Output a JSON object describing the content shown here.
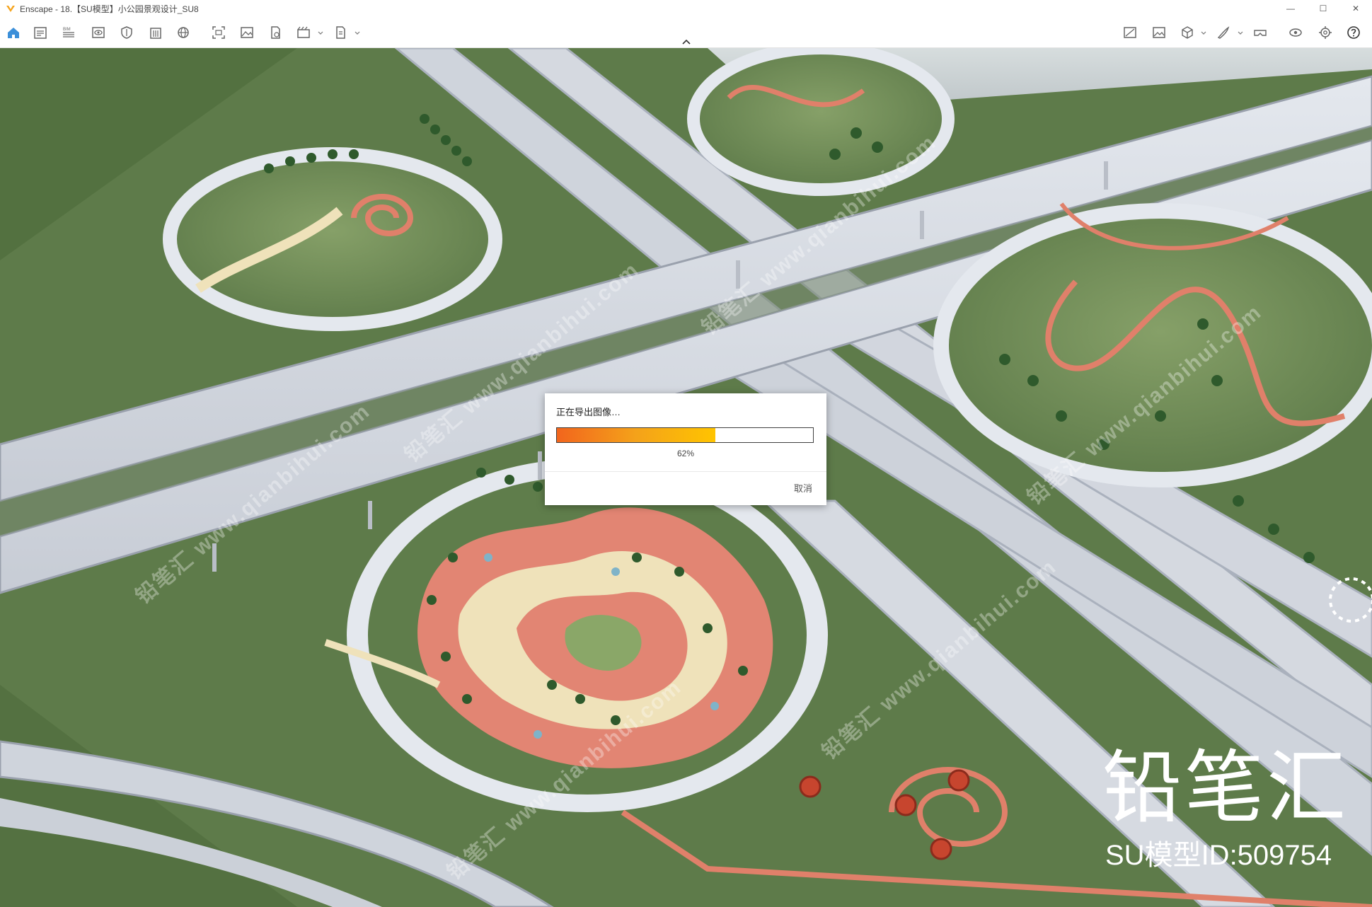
{
  "window": {
    "title": "Enscape - 18.【SU模型】小公园景观设计_SU8",
    "minimize": "—",
    "maximize": "☐",
    "close": "✕"
  },
  "toolbar": {
    "left_icons": [
      "home-icon",
      "document-icon",
      "bim-icon",
      "eye-icon",
      "shield-icon",
      "building-icon",
      "globe-icon",
      "screenshot-icon",
      "image-icon",
      "export-icon",
      "video-icon",
      "file-export-icon"
    ],
    "right_icons": [
      "asset-library-icon",
      "gallery-icon",
      "cube-icon",
      "brush-icon",
      "vr-headset-icon",
      "visibility-icon",
      "settings-icon",
      "help-icon"
    ]
  },
  "dialog": {
    "title": "正在导出图像…",
    "progress_value": 0.62,
    "progress_text": "62%",
    "cancel": "取消"
  },
  "watermark": {
    "brand": "铅笔汇",
    "model_id": "SU模型ID:509754",
    "diagonal_text": "铅笔汇 www.qianbihui.com"
  },
  "colors": {
    "grass": "#5d7a49",
    "road": "#d3d8df",
    "path_red": "#e0806a",
    "path_cream": "#efe2ba",
    "progress_start": "#f2651d",
    "progress_end": "#ffc400"
  }
}
